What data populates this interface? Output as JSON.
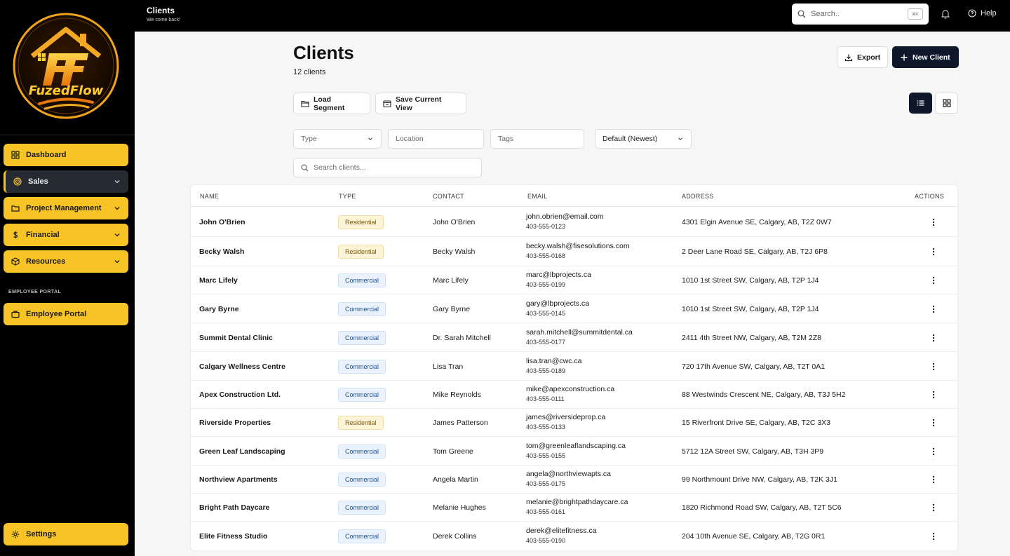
{
  "topbar": {
    "title": "Clients",
    "subtitle": "We come back!",
    "search_placeholder": "Search..",
    "search_shortcut": "⌘K",
    "help_label": "Help"
  },
  "brand": {
    "logo_text": "FuzedFlow"
  },
  "sidebar": {
    "items": [
      {
        "label": "Dashboard",
        "icon": "grid-icon"
      },
      {
        "label": "Sales",
        "icon": "target-icon"
      },
      {
        "label": "Project Management",
        "icon": "folder-icon"
      },
      {
        "label": "Financial",
        "icon": "dollar-icon"
      },
      {
        "label": "Resources",
        "icon": "box-icon"
      }
    ],
    "section_label": "EMPLOYEE PORTAL",
    "employee_portal_label": "Employee Portal",
    "settings_label": "Settings"
  },
  "main": {
    "title": "Clients",
    "count_text": "12 clients",
    "export_label": "Export",
    "new_client_label": "New Client",
    "load_segment_label": "Load Segment",
    "save_view_label": "Save Current View",
    "filters": {
      "type_placeholder": "Type",
      "location_placeholder": "Location",
      "tags_placeholder": "Tags",
      "sort_value": "Default (Newest)",
      "search_placeholder": "Search clients..."
    }
  },
  "table": {
    "columns": [
      "NAME",
      "TYPE",
      "CONTACT",
      "EMAIL",
      "ADDRESS",
      "ACTIONS"
    ],
    "rows": [
      {
        "name": "John O'Brien",
        "type": "Residential",
        "contact": "John O'Brien",
        "email": "john.obrien@email.com",
        "phone": "403-555-0123",
        "address": "4301 Elgin Avenue SE, Calgary, AB, T2Z 0W7"
      },
      {
        "name": "Becky Walsh",
        "type": "Residential",
        "contact": "Becky Walsh",
        "email": "becky.walsh@fisesolutions.com",
        "phone": "403-555-0168",
        "address": "2 Deer Lane Road SE, Calgary, AB, T2J 6P8"
      },
      {
        "name": "Marc Lifely",
        "type": "Commercial",
        "contact": "Marc Lifely",
        "email": "marc@lbprojects.ca",
        "phone": "403-555-0199",
        "address": "1010 1st Street SW, Calgary, AB, T2P 1J4"
      },
      {
        "name": "Gary Byrne",
        "type": "Commercial",
        "contact": "Gary Byrne",
        "email": "gary@lbprojects.ca",
        "phone": "403-555-0145",
        "address": "1010 1st Street SW, Calgary, AB, T2P 1J4"
      },
      {
        "name": "Summit Dental Clinic",
        "type": "Commercial",
        "contact": "Dr. Sarah Mitchell",
        "email": "sarah.mitchell@summitdental.ca",
        "phone": "403-555-0177",
        "address": "2411 4th Street NW, Calgary, AB, T2M 2Z8"
      },
      {
        "name": "Calgary Wellness Centre",
        "type": "Commercial",
        "contact": "Lisa Tran",
        "email": "lisa.tran@cwc.ca",
        "phone": "403-555-0189",
        "address": "720 17th Avenue SW, Calgary, AB, T2T 0A1"
      },
      {
        "name": "Apex Construction Ltd.",
        "type": "Commercial",
        "contact": "Mike Reynolds",
        "email": "mike@apexconstruction.ca",
        "phone": "403-555-0111",
        "address": "88 Westwinds Crescent NE, Calgary, AB, T3J 5H2"
      },
      {
        "name": "Riverside Properties",
        "type": "Residential",
        "contact": "James Patterson",
        "email": "james@riversideprop.ca",
        "phone": "403-555-0133",
        "address": "15 Riverfront Drive SE, Calgary, AB, T2C 3X3"
      },
      {
        "name": "Green Leaf Landscaping",
        "type": "Commercial",
        "contact": "Tom Greene",
        "email": "tom@greenleaflandscaping.ca",
        "phone": "403-555-0155",
        "address": "5712 12A Street SW, Calgary, AB, T3H 3P9"
      },
      {
        "name": "Northview Apartments",
        "type": "Commercial",
        "contact": "Angela Martin",
        "email": "angela@northviewapts.ca",
        "phone": "403-555-0175",
        "address": "99 Northmount Drive NW, Calgary, AB, T2K 3J1"
      },
      {
        "name": "Bright Path Daycare",
        "type": "Commercial",
        "contact": "Melanie Hughes",
        "email": "melanie@brightpathdaycare.ca",
        "phone": "403-555-0161",
        "address": "1820 Richmond Road SW, Calgary, AB, T2T 5C6"
      },
      {
        "name": "Elite Fitness Studio",
        "type": "Commercial",
        "contact": "Derek Collins",
        "email": "derek@elitefitness.ca",
        "phone": "403-555-0190",
        "address": "204 10th Avenue SE, Calgary, AB, T2G 0R1"
      }
    ]
  },
  "colors": {
    "accent": "#f7c325",
    "dark": "#0f172a",
    "residential_bg": "#fdf3d7",
    "commercial_bg": "#eaf2fd"
  }
}
